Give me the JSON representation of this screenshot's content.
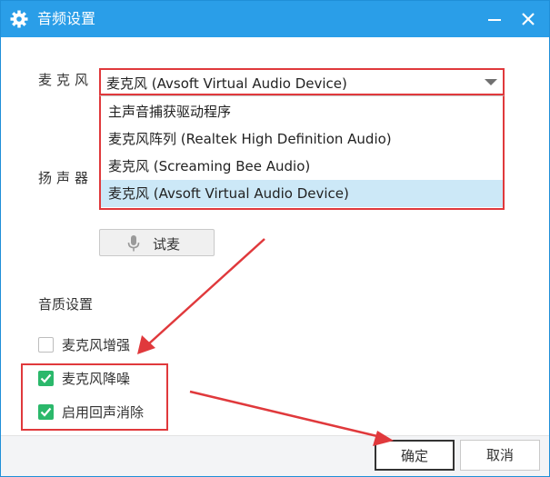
{
  "window": {
    "title": "音频设置",
    "icons": {
      "title": "gear-icon",
      "minimize": "minimize-icon",
      "close": "close-icon"
    }
  },
  "microphone": {
    "label": "麦克风",
    "selected": "麦克风 (Avsoft Virtual Audio Device)",
    "options": [
      "主声音捕获驱动程序",
      "麦克风阵列 (Realtek High Definition Audio)",
      "麦克风 (Screaming Bee Audio)",
      "麦克风 (Avsoft Virtual Audio Device)"
    ],
    "highlighted_index": 3
  },
  "speaker": {
    "label": "扬声器"
  },
  "test_button": {
    "label": "试麦",
    "icon": "microphone-icon"
  },
  "quality": {
    "label": "音质设置",
    "options": [
      {
        "label": "麦克风增强",
        "checked": false
      },
      {
        "label": "麦克风降噪",
        "checked": true
      },
      {
        "label": "启用回声消除",
        "checked": true
      }
    ]
  },
  "footer": {
    "ok_label": "确定",
    "cancel_label": "取消"
  },
  "colors": {
    "titlebar": "#2a9ee8",
    "highlight": "#e0393c",
    "checkbox": "#2bb86b",
    "selected_item": "#cce8f7"
  }
}
